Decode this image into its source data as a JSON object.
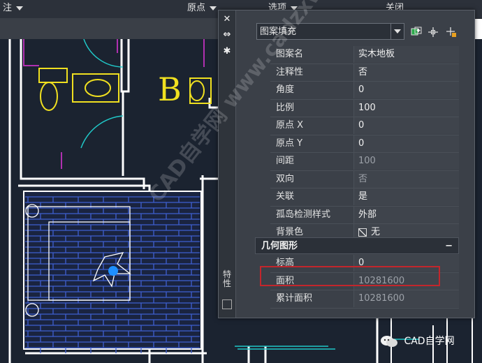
{
  "toolbar": {
    "items": [
      "注",
      "原点",
      "选项",
      "关闭"
    ]
  },
  "palette": {
    "object_type": "图案填充",
    "properties": [
      {
        "key": "图案名",
        "value": "实木地板",
        "dim": false
      },
      {
        "key": "注释性",
        "value": "否",
        "dim": false
      },
      {
        "key": "角度",
        "value": "0",
        "dim": false
      },
      {
        "key": "比例",
        "value": "100",
        "dim": false
      },
      {
        "key": "原点 X",
        "value": "0",
        "dim": false
      },
      {
        "key": "原点 Y",
        "value": "0",
        "dim": false
      },
      {
        "key": "间距",
        "value": "100",
        "dim": true
      },
      {
        "key": "双向",
        "value": "否",
        "dim": true
      },
      {
        "key": "关联",
        "value": "是",
        "dim": false
      },
      {
        "key": "孤岛检测样式",
        "value": "外部",
        "dim": false
      },
      {
        "key": "背景色",
        "value": "无",
        "dim": false
      }
    ],
    "section_geometry": "几何图形",
    "section_toggle": "−",
    "geometry": [
      {
        "key": "标高",
        "value": "0",
        "dim": false
      },
      {
        "key": "面积",
        "value": "10281600",
        "dim": true
      },
      {
        "key": "累计面积",
        "value": "10281600",
        "dim": true
      }
    ],
    "vertical_title": "特性"
  },
  "drawing": {
    "room_label": "B"
  },
  "watermark": {
    "text": "CAD自学网",
    "diagonal_text": "CAD自学网 www.cadzxw.com"
  },
  "colors": {
    "highlight": "#c3262c",
    "wall": "#ffffff",
    "hatch": "#3f5fd0",
    "fixture": "#f0e020",
    "door": "#20c8c8",
    "magenta": "#b030b0"
  }
}
